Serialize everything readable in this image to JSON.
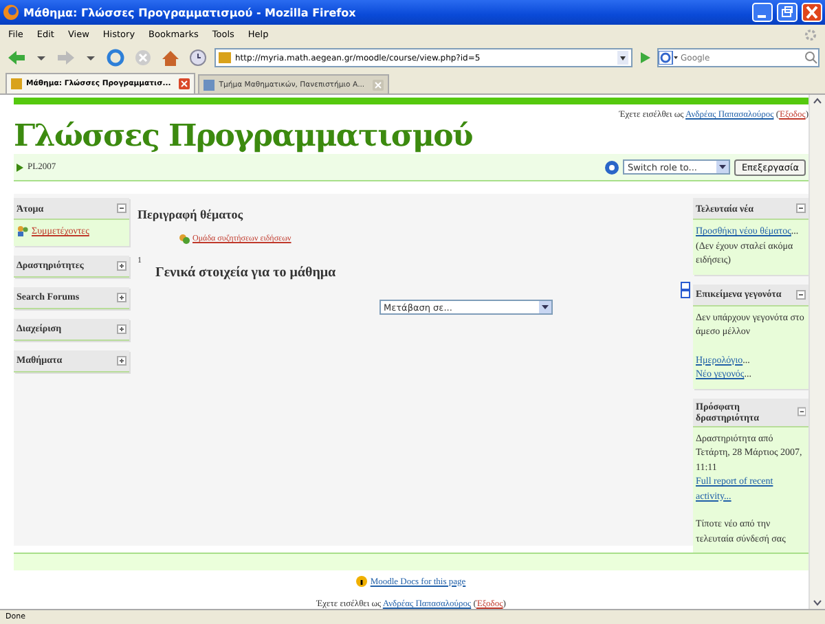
{
  "window": {
    "title": "Μάθημα: Γλώσσες Προγραμματισμού - Mozilla Firefox"
  },
  "menu": [
    "File",
    "Edit",
    "View",
    "History",
    "Bookmarks",
    "Tools",
    "Help"
  ],
  "address": {
    "value": "http://myria.math.aegean.gr/moodle/course/view.php?id=5"
  },
  "search": {
    "placeholder": "Google"
  },
  "tabs": [
    {
      "label": "Μάθημα: Γλώσσες Προγραμματισ...",
      "selected": true
    },
    {
      "label": "Τμήμα Μαθηματικών, Πανεπιστήμιο Α...",
      "selected": false
    }
  ],
  "header": {
    "login": [
      {
        "kind": "text",
        "text": "Έχετε εισέλθει ως "
      },
      {
        "kind": "link",
        "text": "Ανδρέας Παπασαλούρος"
      },
      {
        "kind": "text",
        "text": " ("
      },
      {
        "kind": "logout",
        "text": "Έξοδος"
      },
      {
        "kind": "text",
        "text": ")"
      }
    ],
    "course_title": "Γλώσσες Προγραμματισμού",
    "breadcrumb": "PL2007",
    "role_select": "Switch role to...",
    "edit_button": "Επεξεργασία"
  },
  "left_blocks": [
    {
      "title": "Άτομα",
      "expanded": true,
      "items": [
        {
          "kind": "link",
          "text": "Συμμετέχοντες"
        }
      ]
    },
    {
      "title": "Δραστηριότητες",
      "expanded": false
    },
    {
      "title": "Search Forums",
      "expanded": false
    },
    {
      "title": "Διαχείριση",
      "expanded": false
    },
    {
      "title": "Μαθήματα",
      "expanded": false
    }
  ],
  "main": {
    "heading": "Περιγραφή θέματος",
    "forum_link": "Ομάδα συζητήσεων ειδήσεων",
    "section_number": "1",
    "section_title": "Γενικά στοιχεία για το μάθημα",
    "jump_select": "Μετάβαση σε..."
  },
  "right_blocks": [
    {
      "title": "Τελευταία νέα",
      "expanded": true,
      "items": [
        {
          "kind": "link",
          "text": "Προσθήκη νέου θέματος",
          "suffix": "..."
        },
        {
          "kind": "text",
          "text": "(Δεν έχουν σταλεί ακόμα ειδήσεις)"
        }
      ]
    },
    {
      "title": "Επικείμενα γεγονότα",
      "expanded": true,
      "items": [
        {
          "kind": "text",
          "text": "Δεν υπάρχουν γεγονότα στο άμεσο μέλλον"
        },
        {
          "kind": "gap"
        },
        {
          "kind": "link",
          "text": "Ημερολόγιο",
          "suffix": "..."
        },
        {
          "kind": "link",
          "text": "Νέο γεγονός",
          "suffix": "..."
        }
      ]
    },
    {
      "title": "Πρόσφατη δραστηριότητα",
      "expanded": true,
      "items": [
        {
          "kind": "text",
          "text": "Δραστηριότητα από Τετάρτη, 28 Μάρτιος 2007, 11:11"
        },
        {
          "kind": "link",
          "text": "Full report of recent activity..."
        },
        {
          "kind": "gap"
        },
        {
          "kind": "text",
          "text": "Τίποτε νέο από την τελευταία σύνδεσή σας"
        }
      ]
    }
  ],
  "footer": {
    "docs_link": "Moodle Docs for this page",
    "login": [
      {
        "kind": "text",
        "text": "Έχετε εισέλθει ως "
      },
      {
        "kind": "link",
        "text": "Ανδρέας Παπασαλούρος"
      },
      {
        "kind": "text",
        "text": " ("
      },
      {
        "kind": "logout",
        "text": "Έξοδος"
      },
      {
        "kind": "text",
        "text": ")"
      }
    ]
  },
  "status_bar": "Done"
}
